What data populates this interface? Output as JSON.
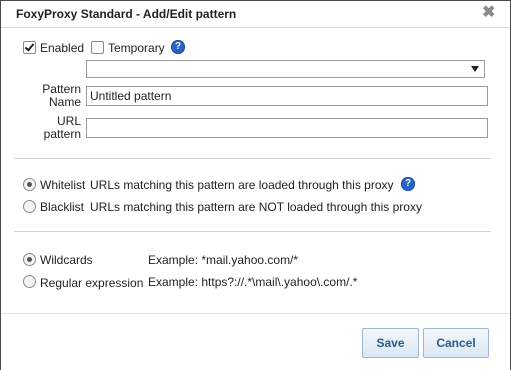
{
  "window": {
    "title": "FoxyProxy Standard - Add/Edit pattern",
    "close_glyph": "✖"
  },
  "options": {
    "enabled_label": "Enabled",
    "enabled_checked": true,
    "temporary_label": "Temporary",
    "temporary_checked": false,
    "help_glyph": "?"
  },
  "form": {
    "select_value": "",
    "pattern_name_label_line1": "Pattern",
    "pattern_name_label_line2": "Name",
    "pattern_name_value": "Untitled pattern",
    "url_pattern_label_line1": "URL",
    "url_pattern_label_line2": "pattern",
    "url_pattern_value": ""
  },
  "list_type": {
    "whitelist_label": "Whitelist",
    "whitelist_desc": "URLs matching this pattern are loaded through this proxy",
    "blacklist_label": "Blacklist",
    "blacklist_desc": "URLs matching this pattern are NOT loaded through this proxy",
    "selected": "whitelist"
  },
  "match_type": {
    "wildcards_label": "Wildcards",
    "wildcards_example": "Example: *mail.yahoo.com/*",
    "regex_label": "Regular expression",
    "regex_example": "Example: https?://.*\\mail\\.yahoo\\.com/.*",
    "selected": "wildcards"
  },
  "buttons": {
    "save_label": "Save",
    "cancel_label": "Cancel",
    "accent": "#2a5b8a"
  }
}
